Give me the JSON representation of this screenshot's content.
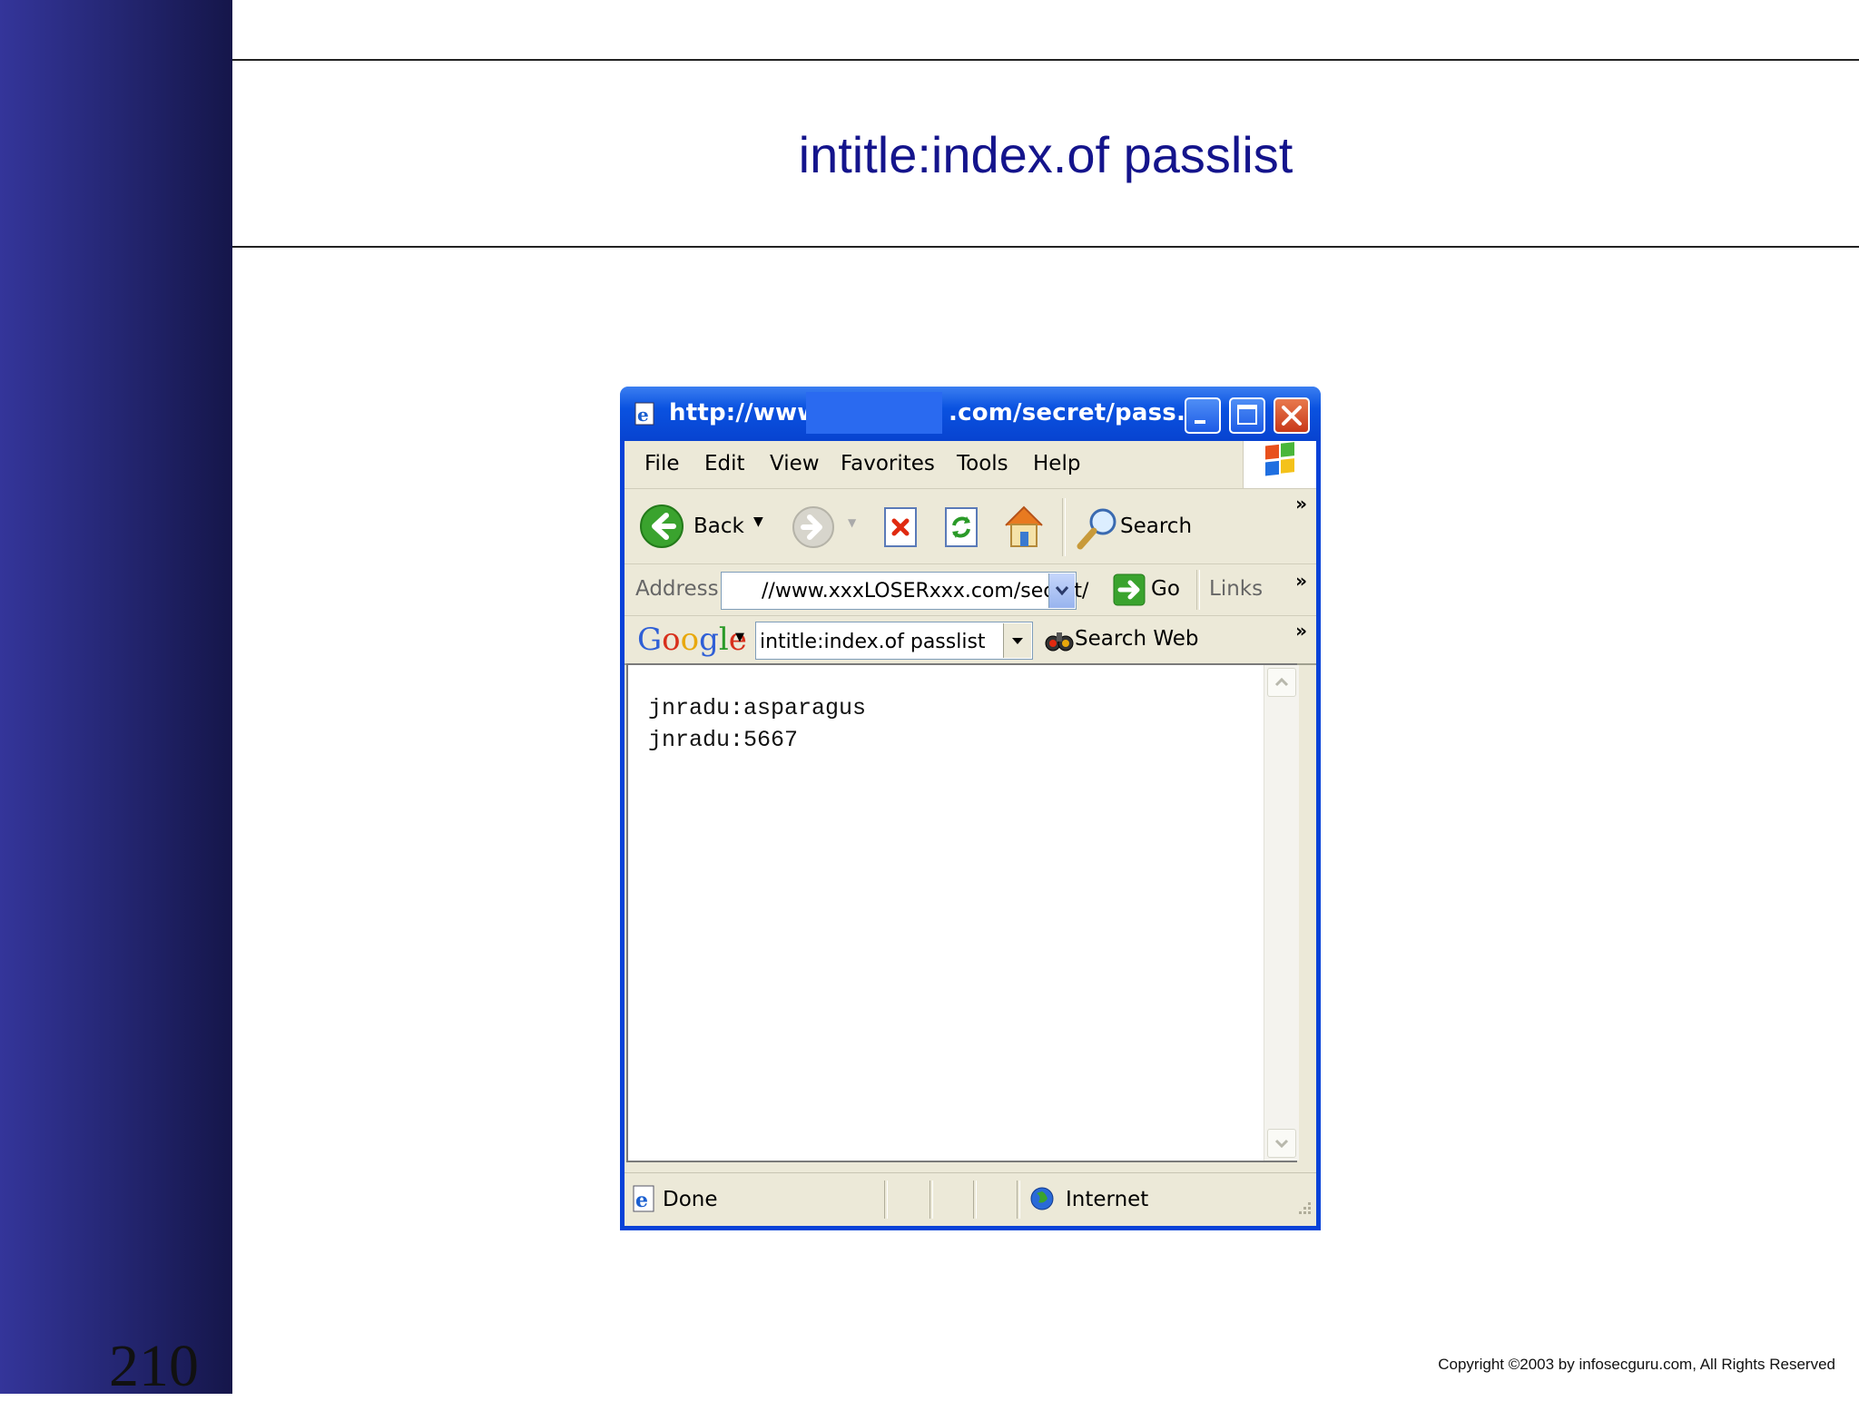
{
  "slide": {
    "title": "intitle:index.of passlist",
    "page_number": "210",
    "copyright": "Copyright  ©2003 by infosecguru.com, All Rights Reserved"
  },
  "browser": {
    "window_title_prefix": "http://www.",
    "window_title_suffix": ".com/secret/pass...",
    "menu": [
      "File",
      "Edit",
      "View",
      "Favorites",
      "Tools",
      "Help"
    ],
    "toolbar": {
      "back_label": "Back",
      "search_label": "Search",
      "overflow": "»"
    },
    "address": {
      "label": "Address",
      "value": "//www.xxxLOSERxxx.com/secret/",
      "go_label": "Go",
      "links_label": "Links"
    },
    "google_bar": {
      "logo": "Google",
      "query": "intitle:index.of passlist",
      "search_web_label": "Search Web"
    },
    "content_lines": [
      "jnradu:asparagus",
      "jnradu:5667"
    ],
    "status": {
      "text": "Done",
      "zone": "Internet"
    }
  },
  "colors": {
    "sidebar": "#262877",
    "title": "#14148c",
    "titlebar": "#0a52e0",
    "chrome": "#ece9d8"
  },
  "icons": [
    "ie-page-icon",
    "minimize-icon",
    "maximize-icon",
    "close-icon",
    "windows-logo-icon",
    "back-arrow-icon",
    "forward-arrow-icon",
    "stop-icon",
    "refresh-icon",
    "home-icon",
    "search-magnifier-icon",
    "go-arrow-icon",
    "binoculars-icon",
    "globe-icon"
  ]
}
